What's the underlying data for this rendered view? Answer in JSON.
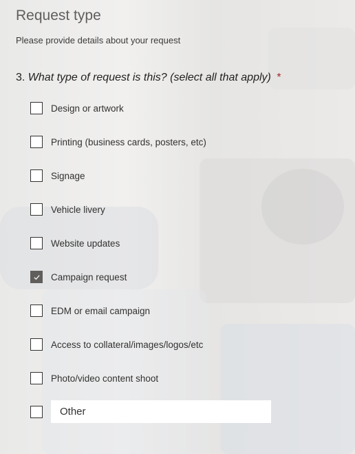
{
  "section": {
    "title": "Request type",
    "subtitle": "Please provide details about your request"
  },
  "question": {
    "number": "3.",
    "text": "What type of request is this? (select all that apply)",
    "required_marker": "*"
  },
  "options": [
    {
      "label": "Design or artwork",
      "checked": false
    },
    {
      "label": "Printing (business cards, posters, etc)",
      "checked": false
    },
    {
      "label": "Signage",
      "checked": false
    },
    {
      "label": "Vehicle livery",
      "checked": false
    },
    {
      "label": "Website updates",
      "checked": false
    },
    {
      "label": "Campaign request",
      "checked": true
    },
    {
      "label": "EDM or email campaign",
      "checked": false
    },
    {
      "label": "Access to collateral/images/logos/etc",
      "checked": false
    },
    {
      "label": "Photo/video content shoot",
      "checked": false
    }
  ],
  "other": {
    "checked": false,
    "placeholder": "Other"
  },
  "colors": {
    "checked_fill": "#605e5c",
    "required": "#a4262c",
    "title": "#605e5c"
  },
  "icons": {
    "checkmark": "check-icon"
  }
}
